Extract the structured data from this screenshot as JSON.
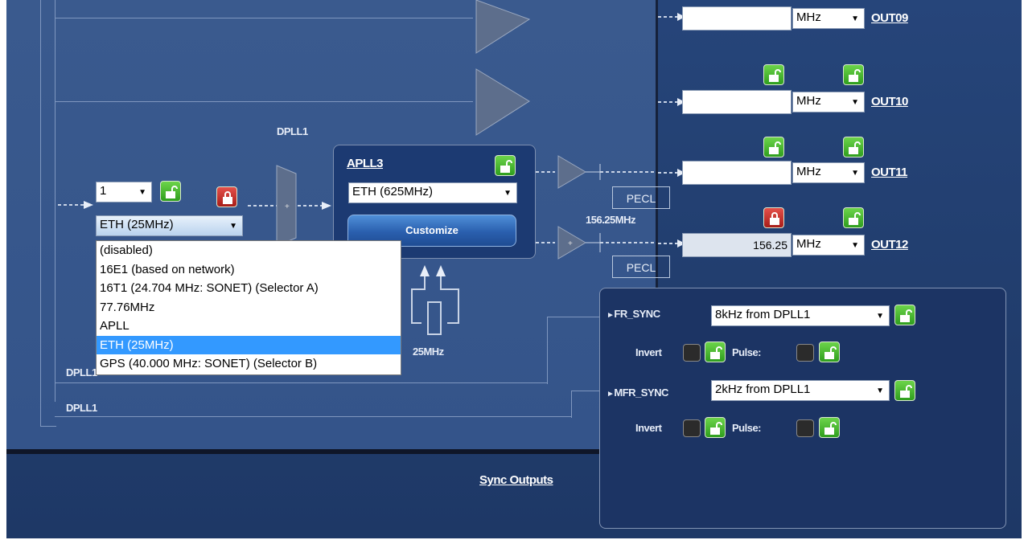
{
  "outputs": [
    {
      "id": "out09",
      "label": "OUT09",
      "value": "",
      "unit": "MHz"
    },
    {
      "id": "out10",
      "label": "OUT10",
      "value": "",
      "unit": "MHz"
    },
    {
      "id": "out11",
      "label": "OUT11",
      "value": "",
      "unit": "MHz",
      "driver": "PECL"
    },
    {
      "id": "out12",
      "label": "OUT12",
      "value": "156.25",
      "unit": "MHz",
      "driver": "PECL",
      "freq_label": "156.25MHz"
    }
  ],
  "dpll_labels": {
    "top": "DPLL1",
    "bottom1": "DPLL1",
    "bottom2": "DPLL1"
  },
  "input": {
    "priority": "1",
    "source_selected": "ETH (25MHz)",
    "options": [
      "(disabled)",
      "16E1 (based on network)",
      "16T1 (24.704 MHz: SONET) (Selector A)",
      "77.76MHz",
      "APLL",
      "ETH (25MHz)",
      "GPS (40.000 MHz: SONET) (Selector B)"
    ],
    "selected_index": 5
  },
  "apll": {
    "title": "APLL3",
    "selected": "ETH (625MHz)",
    "customize_label": "Customize"
  },
  "crystal": {
    "freq": "25MHz"
  },
  "sync": {
    "fr_sync": {
      "label": "FR_SYNC",
      "value": "8kHz from DPLL1"
    },
    "mfr_sync": {
      "label": "MFR_SYNC",
      "value": "2kHz from DPLL1"
    },
    "invert_label": "Invert",
    "pulse_label": "Pulse:",
    "title": "Sync Outputs"
  },
  "colors": {
    "accent_green": "#3fae2a",
    "lock_red": "#c8312b",
    "selection_blue": "#3399ff"
  }
}
